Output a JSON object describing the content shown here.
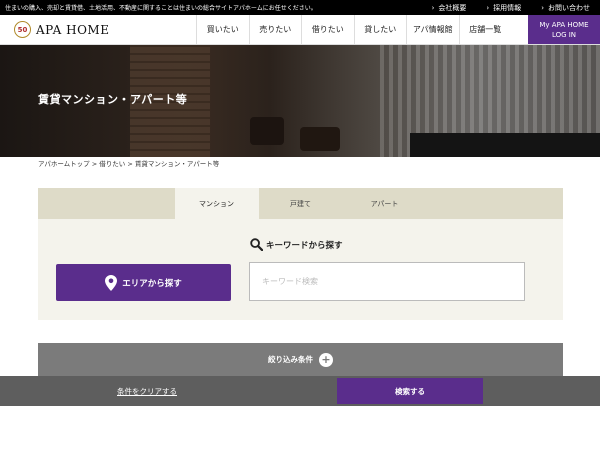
{
  "topbar": {
    "tagline": "住まいの購入、売却と賃貸借、土地活用、不動産に関することは住まいの総合サイトアパホームにお任せください。",
    "links": [
      {
        "label": "会社概要",
        "icon": "chevron-right-icon"
      },
      {
        "label": "採用情報",
        "icon": "chevron-right-icon"
      },
      {
        "label": "お問い合わせ",
        "icon": "chevron-right-icon"
      }
    ]
  },
  "header": {
    "logo_badge": "50",
    "logo_name": "APA HOME",
    "nav": [
      "買いたい",
      "売りたい",
      "借りたい",
      "貸したい",
      "アパ情報館",
      "店舗一覧"
    ],
    "myapa": {
      "line1": "My APA HOME",
      "line2": "LOG IN"
    }
  },
  "hero": {
    "title": "賃貸マンション・アパート等"
  },
  "breadcrumb": "アパホームトップ > 借りたい > 賃貸マンション・アパート等",
  "search": {
    "tabs": [
      {
        "label": "マンション",
        "active": true
      },
      {
        "label": "戸建て",
        "active": false
      },
      {
        "label": "アパート",
        "active": false
      }
    ],
    "keyword_heading": "キーワードから探す",
    "keyword_icon": "search-icon",
    "keyword_placeholder": "キーワード検索",
    "keyword_value": "",
    "area_button": "エリアから探す",
    "area_icon": "map-pin-icon"
  },
  "filter": {
    "label": "絞り込み条件",
    "icon": "plus-icon"
  },
  "bottom": {
    "clear_label": "条件をクリアする",
    "search_label": "検索する"
  },
  "colors": {
    "accent": "#5a2d8c",
    "panel": "#f4f3ec",
    "tabs": "#dedbc8",
    "filter": "#7b7b7b",
    "bottombar": "#5e5e5e"
  }
}
